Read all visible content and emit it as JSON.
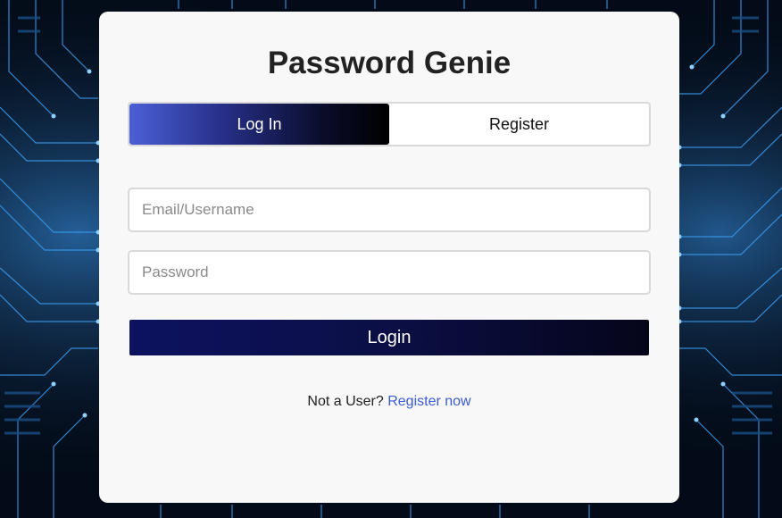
{
  "app": {
    "title": "Password Genie"
  },
  "tabs": [
    {
      "label": "Log In",
      "active": true
    },
    {
      "label": "Register",
      "active": false
    }
  ],
  "form": {
    "email_placeholder": "Email/Username",
    "email_value": "",
    "password_placeholder": "Password",
    "password_value": "",
    "submit_label": "Login"
  },
  "footer": {
    "prompt": "Not a User?",
    "link_label": "Register now"
  },
  "colors": {
    "card_background": "#f8f8f8",
    "accent_blue": "#3b5bd1",
    "tab_active_start": "#4b5fd6",
    "button_dark": "#0b0f45",
    "background_circuit": "#1e7fd6"
  }
}
